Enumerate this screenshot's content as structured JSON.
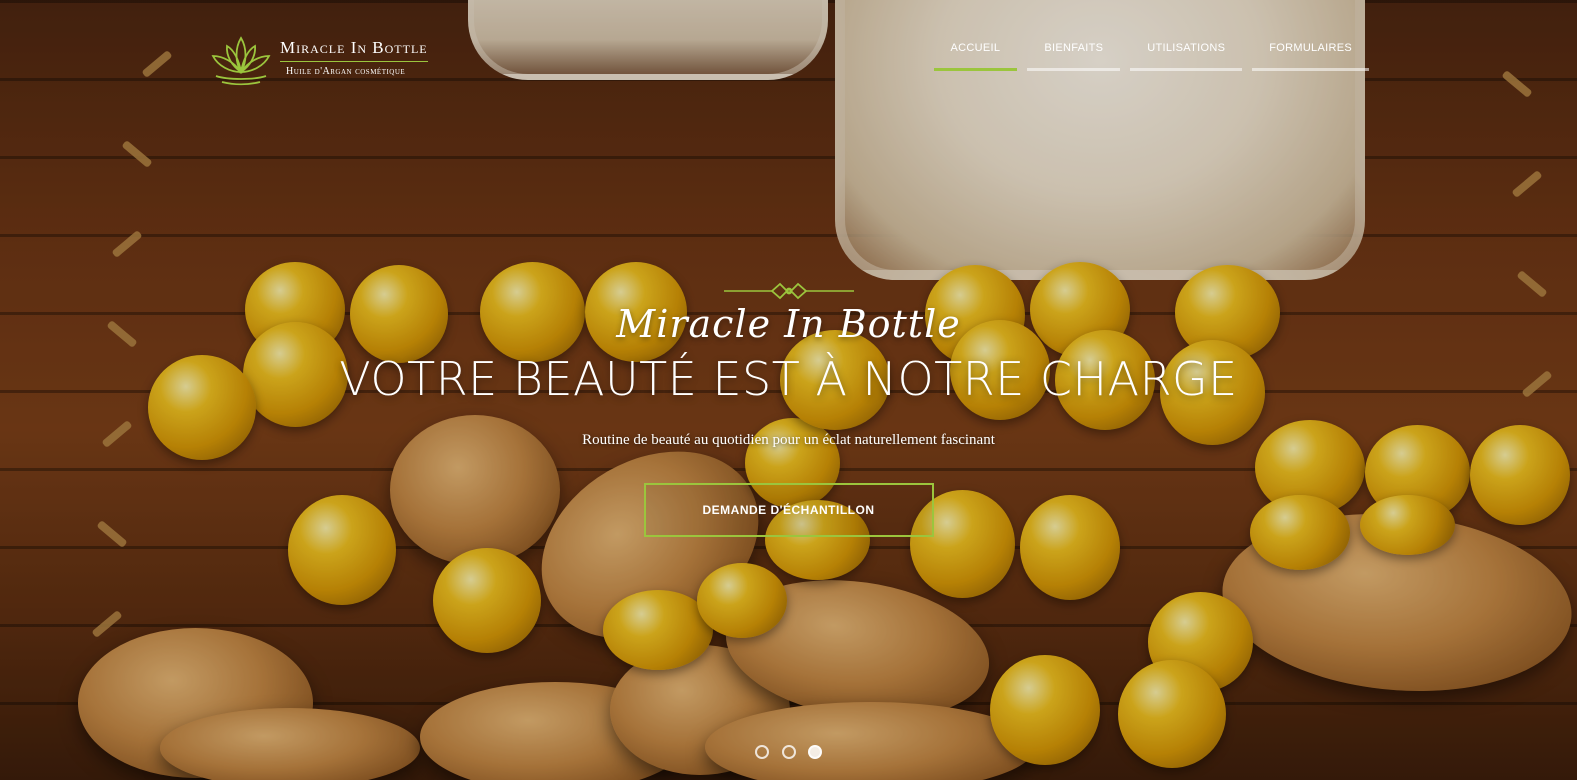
{
  "brand": {
    "name": "Miracle In Bottle",
    "tagline": "Huile d'Argan cosmétique",
    "accent_color": "#9bc53d",
    "icon": "lotus-icon"
  },
  "nav": {
    "items": [
      {
        "label": "Accueil",
        "active": true
      },
      {
        "label": "Bienfaits",
        "active": false
      },
      {
        "label": "Utilisations",
        "active": false
      },
      {
        "label": "Formulaires",
        "active": false
      }
    ]
  },
  "hero": {
    "script_title": "Miracle In Bottle",
    "title": "VOTRE BEAUTÉ EST À NOTRE CHARGE",
    "subtitle": "Routine de beauté au quotidien pour un éclat naturellement fascinant",
    "cta_label": "Demande d'échantillon",
    "ornament": "knot-ornament-icon"
  },
  "carousel": {
    "slide_count": 3,
    "active_index": 2
  }
}
